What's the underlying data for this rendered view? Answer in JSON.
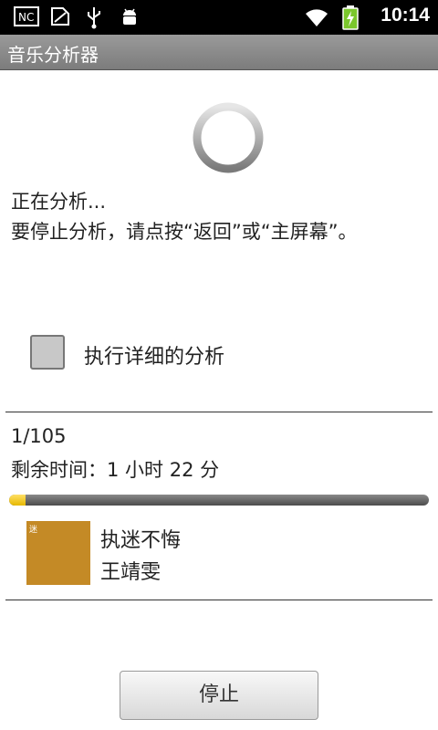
{
  "statusbar": {
    "time": "10:14",
    "icons": [
      "nfc-icon",
      "sim-icon",
      "usb-icon",
      "android-debug-icon",
      "wifi-icon",
      "battery-charging-icon"
    ]
  },
  "titlebar": {
    "title": "音乐分析器"
  },
  "analysis": {
    "status": "正在分析...",
    "hint": "要停止分析，请点按“返回”或“主屏幕”。"
  },
  "detail_checkbox": {
    "label": "执行详细的分析",
    "checked": false
  },
  "progress": {
    "counter": "1/105",
    "remaining": "剩余时间：1 小时 22 分",
    "fraction": 0.04
  },
  "track": {
    "cover_text": "迷",
    "title": "执迷不悔",
    "artist": "王靖雯",
    "cover_color": "#c48a26"
  },
  "stop_button": {
    "label": "停止"
  },
  "colors": {
    "accent": "#e6b800"
  }
}
